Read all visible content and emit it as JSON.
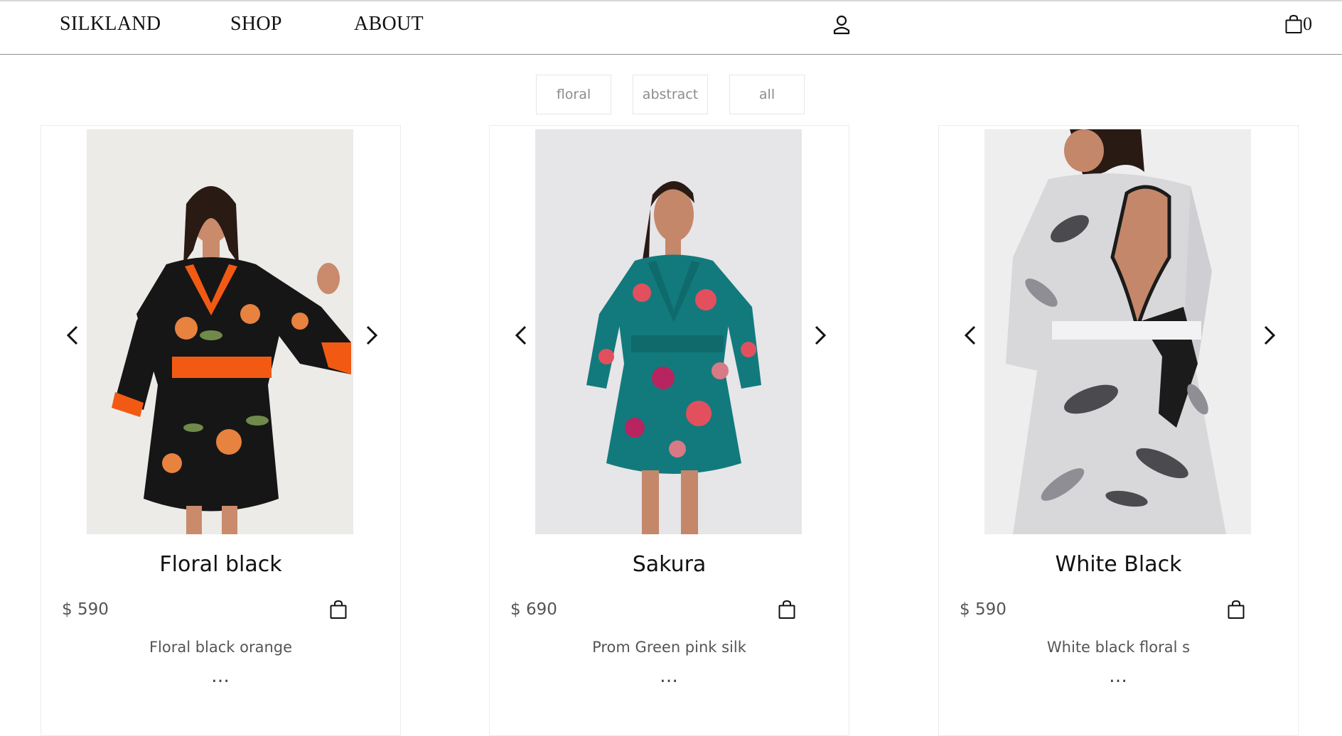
{
  "header": {
    "logo": "SILKLAND",
    "nav": [
      {
        "label": "SHOP"
      },
      {
        "label": "ABOUT"
      }
    ],
    "cart_count": "0"
  },
  "filters": [
    {
      "label": "floral"
    },
    {
      "label": "abstract"
    },
    {
      "label": "all"
    }
  ],
  "products": [
    {
      "title": "Floral black",
      "price": "$ 590",
      "description": "Floral black orange",
      "more": "…",
      "colors": {
        "dress": "#161616",
        "accent": "#f25a14",
        "print": "#e8823f",
        "leaf": "#6f8a4a",
        "background": "#ecebe8"
      }
    },
    {
      "title": "Sakura",
      "price": "$ 690",
      "description": "Prom Green pink silk",
      "more": "…",
      "colors": {
        "dress": "#127a7d",
        "accent": "#e2505e",
        "print": "#b8245f",
        "leaf": "#d77a86",
        "background": "#e6e5e8"
      }
    },
    {
      "title": "White Black",
      "price": "$ 590",
      "description": "White black floral s",
      "more": "…",
      "colors": {
        "dress": "#d8d8db",
        "accent": "#1b1b1b",
        "print": "#4a4a4f",
        "leaf": "#8e8e94",
        "background": "#eeeeef"
      }
    }
  ]
}
